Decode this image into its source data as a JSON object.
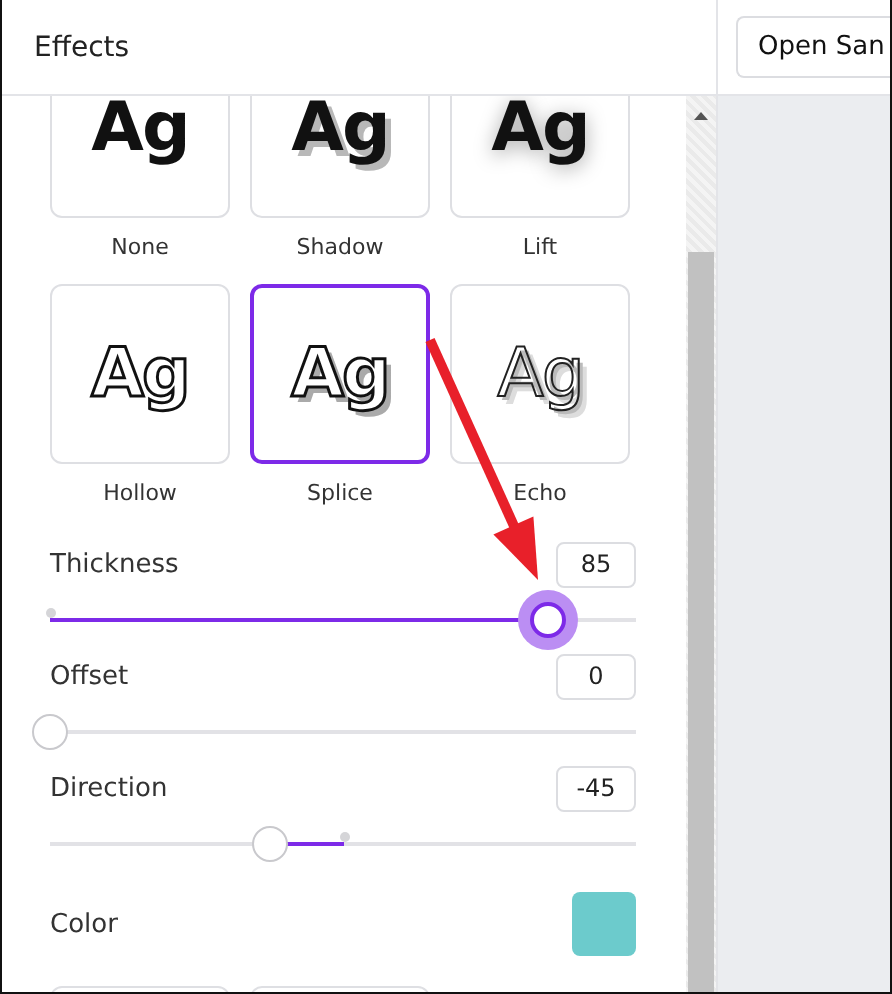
{
  "panel": {
    "title": "Effects"
  },
  "effects": [
    {
      "name": "None",
      "preview": "Ag",
      "kind": "none",
      "selected": false
    },
    {
      "name": "Shadow",
      "preview": "Ag",
      "kind": "shadow",
      "selected": false
    },
    {
      "name": "Lift",
      "preview": "Ag",
      "kind": "lift",
      "selected": false
    },
    {
      "name": "Hollow",
      "preview": "Ag",
      "kind": "hollow",
      "selected": false
    },
    {
      "name": "Splice",
      "preview": "Ag",
      "kind": "splice",
      "selected": true
    },
    {
      "name": "Echo",
      "preview": "Ag",
      "kind": "echo",
      "selected": false
    }
  ],
  "sliders": [
    {
      "label": "Thickness",
      "value": "85",
      "kind": "start",
      "level": 0.85,
      "focused": true
    },
    {
      "label": "Offset",
      "value": "0",
      "kind": "start",
      "level": 0,
      "focused": false
    },
    {
      "label": "Direction",
      "value": "-45",
      "kind": "centered",
      "level": 0.375,
      "focused": false
    }
  ],
  "color": {
    "label": "Color",
    "color": "#6ccbcc"
  },
  "toolbar": {
    "font_button": "Open San"
  },
  "annotation": {
    "kind": "arrow"
  }
}
